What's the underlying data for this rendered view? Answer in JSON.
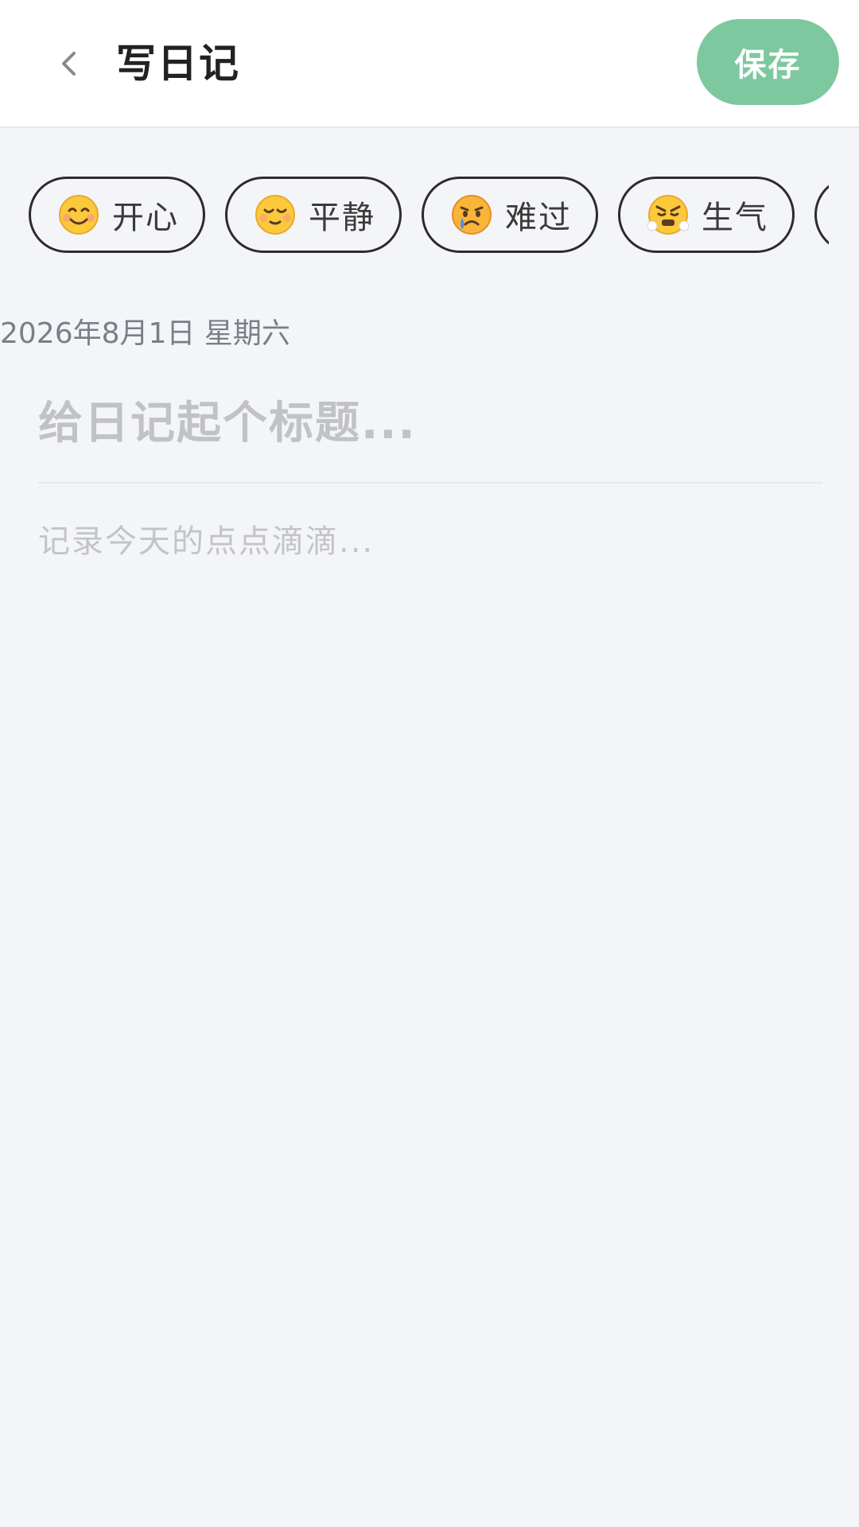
{
  "header": {
    "title": "写日记",
    "back_icon": "chevron-left-icon",
    "save_label": "保存",
    "save_color": "#7dc89f"
  },
  "moods": [
    {
      "emoji": "smiling-face-icon",
      "label": "开心"
    },
    {
      "emoji": "relieved-face-icon",
      "label": "平静"
    },
    {
      "emoji": "crying-face-icon",
      "label": "难过"
    },
    {
      "emoji": "angry-face-icon",
      "label": "生气"
    }
  ],
  "date": "2026年8月1日 星期六",
  "title_field": {
    "value": "",
    "placeholder": "给日记起个标题..."
  },
  "content_field": {
    "value": "",
    "placeholder": "记录今天的点点滴滴..."
  }
}
